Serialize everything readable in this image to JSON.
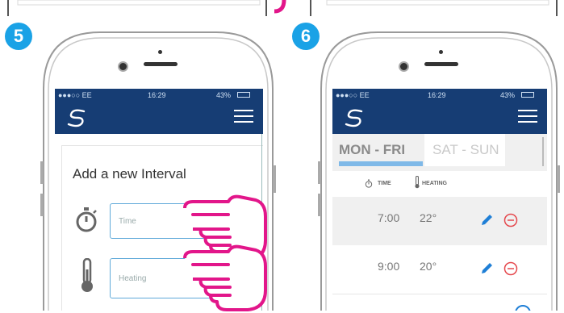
{
  "steps": [
    {
      "number": "5",
      "status": {
        "carrier": "●●●○○ EE",
        "time": "16:29",
        "battery": "43%"
      },
      "form": {
        "title": "Add a new Interval",
        "time_placeholder": "Time",
        "heating_placeholder": "Heating"
      }
    },
    {
      "number": "6",
      "status": {
        "carrier": "●●●○○ EE",
        "time": "16:29",
        "battery": "43%"
      },
      "schedule": {
        "tabs": [
          "MON - FRI",
          "SAT - SUN"
        ],
        "active_tab": "MON - FRI",
        "columns": [
          "TIME",
          "HEATING"
        ],
        "rows": [
          {
            "time": "7:00",
            "temp": "22°"
          },
          {
            "time": "9:00",
            "temp": "20°"
          }
        ]
      }
    }
  ],
  "colors": {
    "brand_navy": "#163d74",
    "badge_blue": "#1aa2e6",
    "tab_active_bar": "#7fb9e8",
    "remove_red": "#e5484d",
    "edit_blue": "#1f7fd6",
    "hand_magenta": "#e2168a"
  }
}
